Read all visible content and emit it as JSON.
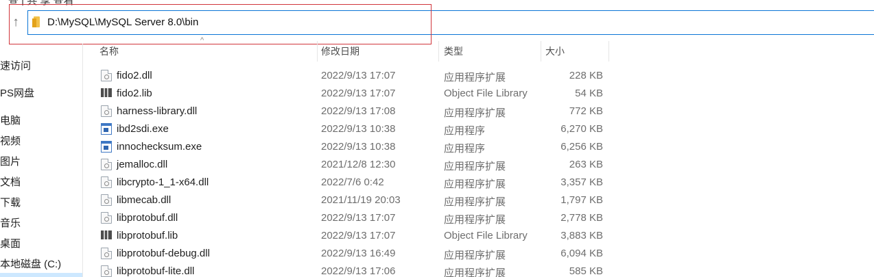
{
  "top_fragment": "查 | 共  享  查看",
  "address": {
    "path": "D:\\MySQL\\MySQL Server 8.0\\bin"
  },
  "nav": {
    "items": [
      {
        "label": "速访问"
      },
      {
        "label": "PS网盘"
      },
      {
        "label": "电脑"
      },
      {
        "label": "视频"
      },
      {
        "label": "图片"
      },
      {
        "label": "文档"
      },
      {
        "label": "下载"
      },
      {
        "label": "音乐"
      },
      {
        "label": "桌面"
      },
      {
        "label": "本地磁盘 (C:)"
      }
    ]
  },
  "columns": {
    "name": "名称",
    "date": "修改日期",
    "type": "类型",
    "size": "大小"
  },
  "files": [
    {
      "name": "fido2.dll",
      "icon": "dll-file-icon",
      "date": "2022/9/13 17:07",
      "type": "应用程序扩展",
      "size": "228 KB"
    },
    {
      "name": "fido2.lib",
      "icon": "lib-file-icon",
      "date": "2022/9/13 17:07",
      "type": "Object File Library",
      "size": "54 KB"
    },
    {
      "name": "harness-library.dll",
      "icon": "dll-file-icon",
      "date": "2022/9/13 17:08",
      "type": "应用程序扩展",
      "size": "772 KB"
    },
    {
      "name": "ibd2sdi.exe",
      "icon": "exe-file-icon",
      "date": "2022/9/13 10:38",
      "type": "应用程序",
      "size": "6,270 KB"
    },
    {
      "name": "innochecksum.exe",
      "icon": "exe-file-icon",
      "date": "2022/9/13 10:38",
      "type": "应用程序",
      "size": "6,256 KB"
    },
    {
      "name": "jemalloc.dll",
      "icon": "dll-file-icon",
      "date": "2021/12/8 12:30",
      "type": "应用程序扩展",
      "size": "263 KB"
    },
    {
      "name": "libcrypto-1_1-x64.dll",
      "icon": "dll-file-icon",
      "date": "2022/7/6 0:42",
      "type": "应用程序扩展",
      "size": "3,357 KB"
    },
    {
      "name": "libmecab.dll",
      "icon": "dll-file-icon",
      "date": "2021/11/19 20:03",
      "type": "应用程序扩展",
      "size": "1,797 KB"
    },
    {
      "name": "libprotobuf.dll",
      "icon": "dll-file-icon",
      "date": "2022/9/13 17:07",
      "type": "应用程序扩展",
      "size": "2,778 KB"
    },
    {
      "name": "libprotobuf.lib",
      "icon": "lib-file-icon",
      "date": "2022/9/13 17:07",
      "type": "Object File Library",
      "size": "3,883 KB"
    },
    {
      "name": "libprotobuf-debug.dll",
      "icon": "dll-file-icon",
      "date": "2022/9/13 16:49",
      "type": "应用程序扩展",
      "size": "6,094 KB"
    },
    {
      "name": "libprotobuf-lite.dll",
      "icon": "dll-file-icon",
      "date": "2022/9/13 17:06",
      "type": "应用程序扩展",
      "size": "585 KB"
    }
  ],
  "colors": {
    "address_border": "#0a74d6",
    "highlight_box": "#d0343a",
    "folder": "#f2c14a"
  }
}
